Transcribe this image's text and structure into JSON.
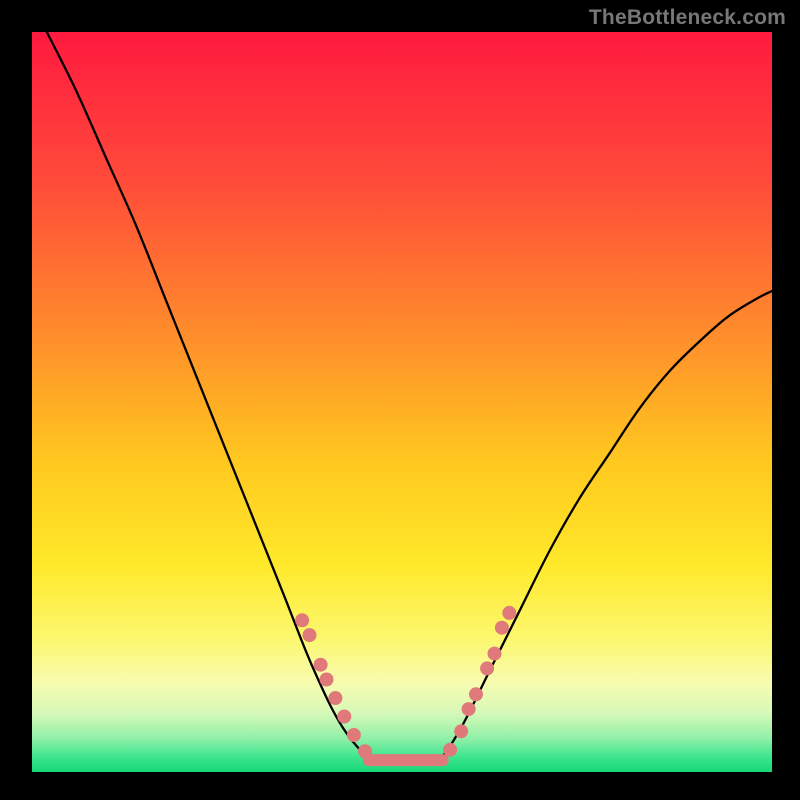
{
  "watermark": "TheBottleneck.com",
  "chart_data": {
    "type": "line",
    "title": "",
    "xlabel": "",
    "ylabel": "",
    "xlim": [
      0,
      100
    ],
    "ylim": [
      0,
      100
    ],
    "grid": false,
    "legend": false,
    "background_gradient": {
      "stops": [
        {
          "offset": 0.0,
          "color": "#ff1a3f"
        },
        {
          "offset": 0.2,
          "color": "#ff4a3a"
        },
        {
          "offset": 0.4,
          "color": "#ff8a2c"
        },
        {
          "offset": 0.58,
          "color": "#ffc81f"
        },
        {
          "offset": 0.72,
          "color": "#ffe92a"
        },
        {
          "offset": 0.82,
          "color": "#fcf76f"
        },
        {
          "offset": 0.88,
          "color": "#f7fcb0"
        },
        {
          "offset": 0.92,
          "color": "#d7f9b8"
        },
        {
          "offset": 0.955,
          "color": "#8ff0a8"
        },
        {
          "offset": 0.98,
          "color": "#3de58e"
        },
        {
          "offset": 1.0,
          "color": "#17d878"
        }
      ]
    },
    "series": [
      {
        "name": "left-curve",
        "type": "line",
        "x": [
          2,
          6,
          10,
          14,
          18,
          22,
          26,
          30,
          34,
          38,
          42,
          46
        ],
        "y": [
          100,
          92,
          83,
          74,
          64,
          54,
          44,
          34,
          24,
          14,
          6,
          1.5
        ]
      },
      {
        "name": "flat-min",
        "type": "line",
        "x": [
          46,
          48,
          50,
          52,
          54,
          55
        ],
        "y": [
          1.5,
          1.3,
          1.2,
          1.2,
          1.3,
          1.5
        ]
      },
      {
        "name": "right-curve",
        "type": "line",
        "x": [
          55,
          58,
          62,
          66,
          70,
          74,
          78,
          82,
          86,
          90,
          94,
          98,
          100
        ],
        "y": [
          1.5,
          6,
          14,
          22,
          30,
          37,
          43,
          49,
          54,
          58,
          61.5,
          64,
          65
        ]
      }
    ],
    "markers": {
      "name": "dots",
      "color": "#e07a7a",
      "radius": 7,
      "points": [
        {
          "x": 36.5,
          "y": 20.5
        },
        {
          "x": 37.5,
          "y": 18.5
        },
        {
          "x": 39.0,
          "y": 14.5
        },
        {
          "x": 39.8,
          "y": 12.5
        },
        {
          "x": 41.0,
          "y": 10.0
        },
        {
          "x": 42.2,
          "y": 7.5
        },
        {
          "x": 43.5,
          "y": 5.0
        },
        {
          "x": 45.0,
          "y": 2.8
        },
        {
          "x": 56.5,
          "y": 3.0
        },
        {
          "x": 58.0,
          "y": 5.5
        },
        {
          "x": 59.0,
          "y": 8.5
        },
        {
          "x": 60.0,
          "y": 10.5
        },
        {
          "x": 61.5,
          "y": 14.0
        },
        {
          "x": 62.5,
          "y": 16.0
        },
        {
          "x": 63.5,
          "y": 19.5
        },
        {
          "x": 64.5,
          "y": 21.5
        }
      ]
    },
    "flat_bar": {
      "name": "min-bar",
      "color": "#e07a7a",
      "x0": 45.5,
      "x1": 55.5,
      "y": 1.6,
      "thickness": 12
    }
  }
}
